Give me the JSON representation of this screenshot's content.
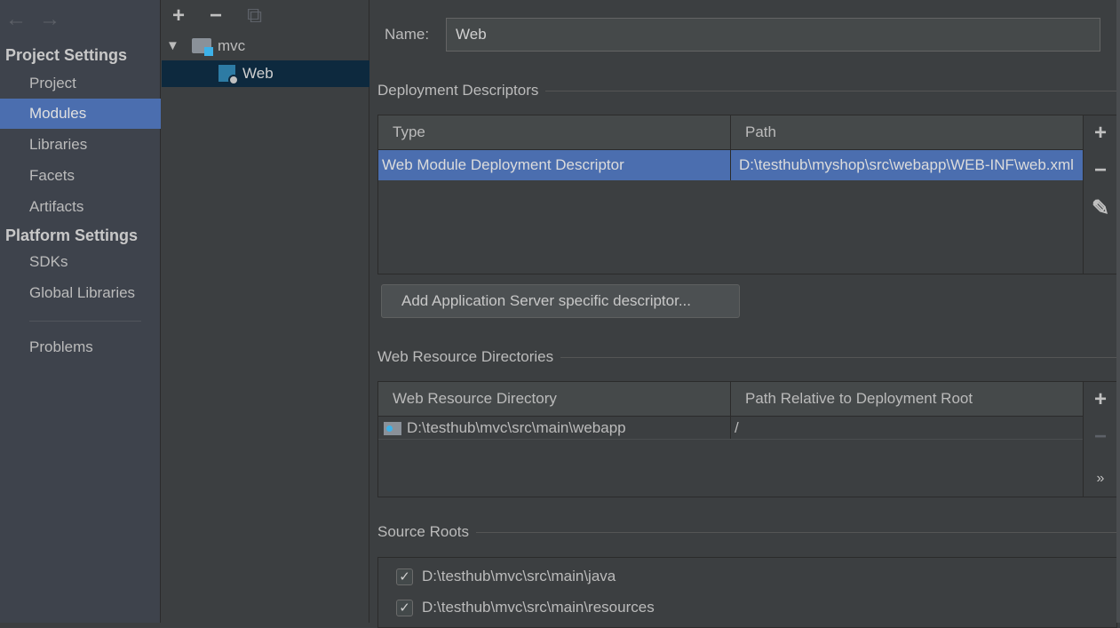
{
  "nav": {
    "back": "←",
    "forward": "→"
  },
  "sidebar": {
    "project_settings": "Project Settings",
    "platform_settings": "Platform Settings",
    "items": [
      "Project",
      "Modules",
      "Libraries",
      "Facets",
      "Artifacts"
    ],
    "platform_items": [
      "SDKs",
      "Global Libraries"
    ],
    "problems": "Problems"
  },
  "tree": {
    "add": "+",
    "remove": "−",
    "copy": "⧉",
    "root": "mvc",
    "child": "Web"
  },
  "main": {
    "name_label": "Name:",
    "name_value": "Web",
    "deployment": {
      "title": "Deployment Descriptors",
      "headers": [
        "Type",
        "Path"
      ],
      "rows": [
        [
          "Web Module Deployment Descriptor",
          "D:\\testhub\\myshop\\src\\webapp\\WEB-INF\\web.xml"
        ]
      ],
      "add_button": "Add Application Server specific descriptor..."
    },
    "web_resources": {
      "title": "Web Resource Directories",
      "headers": [
        "Web Resource Directory",
        "Path Relative to Deployment Root"
      ],
      "rows": [
        [
          "D:\\testhub\\mvc\\src\\main\\webapp",
          "/"
        ]
      ]
    },
    "source_roots": {
      "title": "Source Roots",
      "items": [
        "D:\\testhub\\mvc\\src\\main\\java",
        "D:\\testhub\\mvc\\src\\main\\resources"
      ]
    },
    "icons": {
      "add": "+",
      "remove": "−",
      "edit": "✎",
      "more": "»",
      "check": "✓"
    }
  },
  "colors": {
    "selection": "#4b6eaf",
    "tree_selection": "#0d293e"
  }
}
